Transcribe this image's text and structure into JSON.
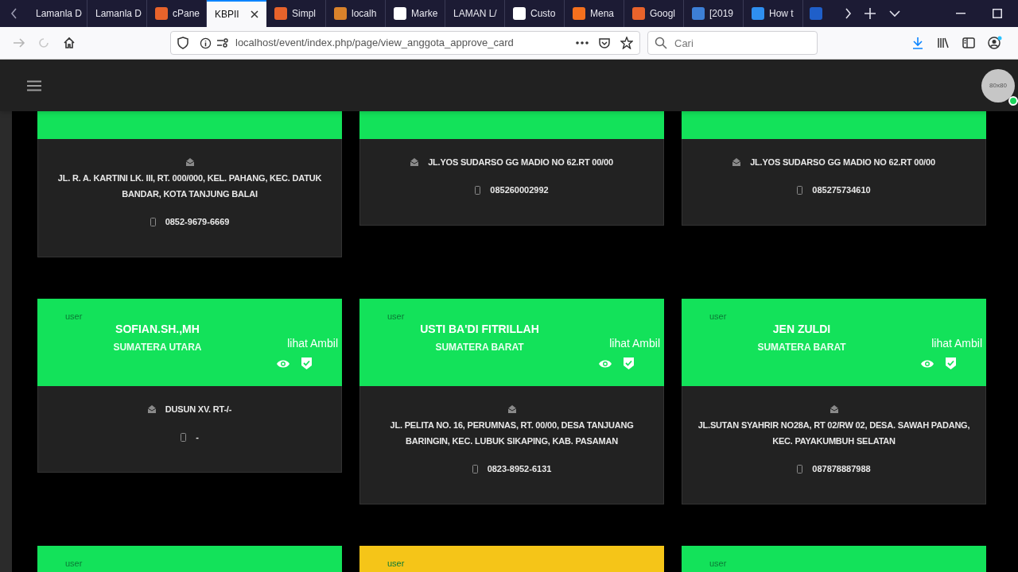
{
  "browser": {
    "tabs": [
      {
        "title": "Lamanla D",
        "selected": false
      },
      {
        "title": "Lamanla D",
        "selected": false
      },
      {
        "title": "cPane",
        "selected": false,
        "color": "#e8632b"
      },
      {
        "title": "KBPII",
        "selected": true
      },
      {
        "title": "Simpl",
        "selected": false,
        "color": "#e8632b"
      },
      {
        "title": "localh",
        "selected": false,
        "color": "#d9822b"
      },
      {
        "title": "Marke",
        "selected": false,
        "color": "#ffffff"
      },
      {
        "title": "LAMAN L/",
        "selected": false
      },
      {
        "title": "Custo",
        "selected": false,
        "color": "#ffffff"
      },
      {
        "title": "Mena",
        "selected": false,
        "color": "#f4701e"
      },
      {
        "title": "Googl",
        "selected": false,
        "color": "#e8632b"
      },
      {
        "title": "[2019",
        "selected": false,
        "color": "#3d7fd6"
      },
      {
        "title": "How t",
        "selected": false,
        "color": "#2f8ff0"
      },
      {
        "selected": false,
        "color": "#1f5fc9"
      }
    ],
    "url": "localhost/event/index.php/page/view_anggota_approve_card",
    "search": {
      "placeholder": "Cari"
    }
  },
  "app_header": {
    "avatar": "80x80"
  },
  "cards": [
    {
      "color": "#13e25a",
      "address": "JL. R. A. KARTINI LK. III, RT. 000/000, KEL. PAHANG, KEC. DATUK BANDAR, KOTA TANJUNG BALAI",
      "phone": "0852-9679-6669"
    },
    {
      "color": "#13e25a",
      "address": "JL.YOS SUDARSO GG MADIO NO 62.RT 00/00",
      "phone": "085260002992"
    },
    {
      "color": "#13e25a",
      "address": "JL.YOS SUDARSO GG MADIO NO 62.RT 00/00",
      "phone": "085275734610"
    },
    {
      "color": "#13e25a",
      "user_label": "user",
      "name": "SOFIAN.SH.,MH",
      "region": "SUMATERA UTARA",
      "actions_label": "lihat Ambil",
      "address": "DUSUN XV. RT-/-",
      "phone": "-"
    },
    {
      "color": "#13e25a",
      "user_label": "user",
      "name": "USTI BA'DI FITRILLAH",
      "region": "SUMATERA BARAT",
      "actions_label": "lihat Ambil",
      "address": "JL. PELITA NO. 16, PERUMNAS, RT. 00/00, DESA TANJUANG BARINGIN, KEC. LUBUK SIKAPING, KAB. PASAMAN",
      "phone": "0823-8952-6131"
    },
    {
      "color": "#13e25a",
      "user_label": "user",
      "name": "JEN ZULDI",
      "region": "SUMATERA BARAT",
      "actions_label": "lihat Ambil",
      "address": "JL.SUTAN SYAHRIR NO28A, RT 02/RW 02, DESA. SAWAH PADANG, KEC. PAYAKUMBUH SELATAN",
      "phone": "087878887988"
    },
    {
      "color": "#13e25a",
      "user_label": "user"
    },
    {
      "color": "#f5c518",
      "user_label": "user"
    },
    {
      "color": "#13e25a",
      "user_label": "user"
    }
  ]
}
